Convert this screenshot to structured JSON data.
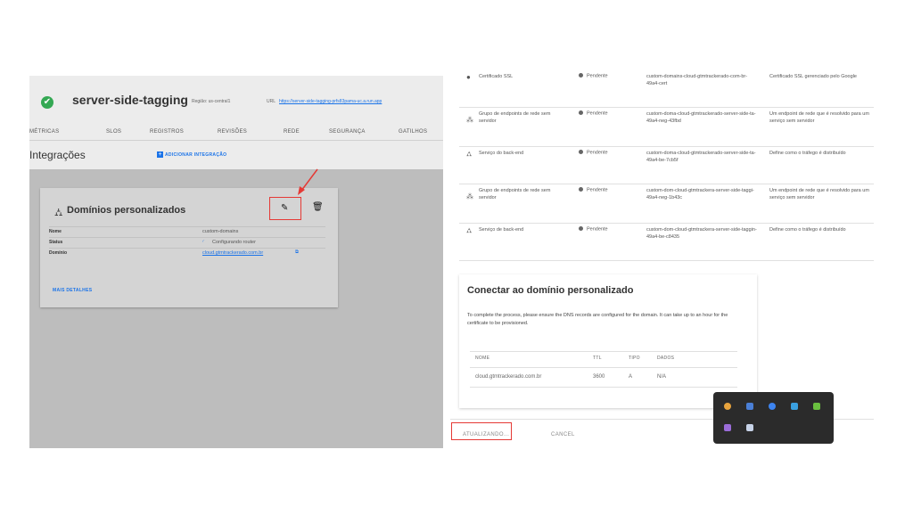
{
  "service": {
    "name": "server-side-tagging",
    "region": "Região: us-central1",
    "url_label": "URL",
    "url": "https://server-side-tagging-prfs83pama-uc.a.run.app"
  },
  "tabs": [
    "MÉTRICAS",
    "SLOS",
    "REGISTROS",
    "REVISÕES",
    "REDE",
    "SEGURANÇA",
    "GATILHOS"
  ],
  "integrations": {
    "title": "Integrações",
    "add_label": "ADICIONAR INTEGRAÇÃO"
  },
  "card": {
    "title": "Domínios personalizados",
    "rows": [
      {
        "label": "Nome",
        "value": "custom-domains"
      },
      {
        "label": "Status",
        "value": "Configurando router"
      },
      {
        "label": "Domínio",
        "value": "cloud.gtmtrackerado.com.br"
      }
    ],
    "more_label": "MAIS DETALHES"
  },
  "resources": [
    {
      "name": "Certificado SSL",
      "status": "Pendente",
      "data": "custom-domains-cloud-gtmtrackerado-com-br-49a4-cert",
      "desc": "Certificado SSL gerenciado pelo Google"
    },
    {
      "name": "Grupo de endpoints de rede sem servidor",
      "status": "Pendente",
      "data": "custom-doma-cloud-gtmtrackerado-server-side-ta-49a4-neg-43fbd",
      "desc": "Um endpoint de rede que é resolvido para um serviço sem servidor"
    },
    {
      "name": "Serviço do back-end",
      "status": "Pendente",
      "data": "custom-doma-cloud-gtmtrackerado-server-side-ta-49a4-be-7cb5f",
      "desc": "Define como o tráfego é distribuído"
    },
    {
      "name": "Grupo de endpoints de rede sem servidor",
      "status": "Pendente",
      "data": "custom-dom-cloud-gtmtrackera-server-side-taggi-49a4-neg-1b43c",
      "desc": "Um endpoint de rede que é resolvido para um serviço sem servidor"
    },
    {
      "name": "Serviço de back-end",
      "status": "Pendente",
      "data": "custom-dom-cloud-gtmtrackera-server-side-taggin-49a4-be-c8435",
      "desc": "Define como o tráfego é distribuído"
    }
  ],
  "connect": {
    "title": "Conectar ao domínio personalizado",
    "desc": "To complete the process, please ensure the DNS records are configured for the domain. It can take up to an hour for the certificate to be provisioned.",
    "headers": [
      "NOME",
      "TTL",
      "TIPO",
      "DADOS"
    ],
    "row": [
      "cloud.gtmtrackerado.com.br",
      "3600",
      "A",
      "N/A"
    ]
  },
  "actions": {
    "update": "ATUALIZANDO...",
    "cancel": "CANCEL"
  },
  "colors": {
    "accent": "#1a73e8",
    "highlight": "#e53935",
    "success": "#34a853"
  }
}
